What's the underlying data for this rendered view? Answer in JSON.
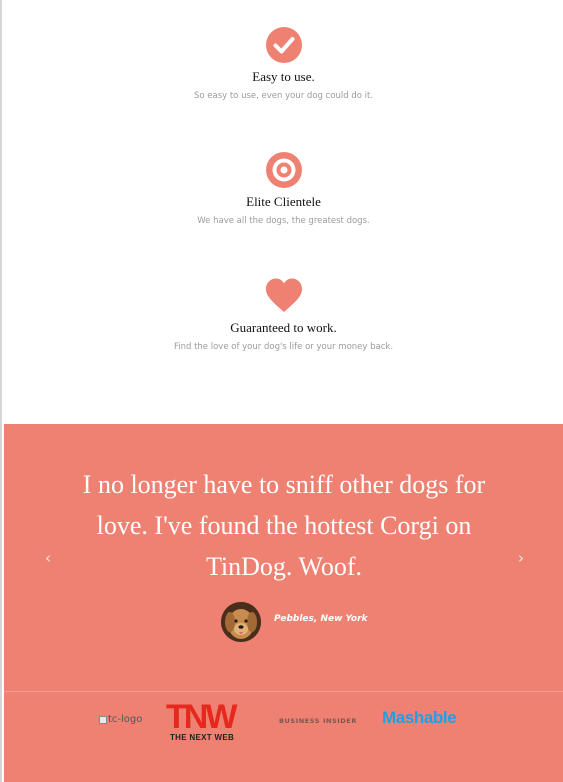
{
  "features": [
    {
      "icon": "check-circle-icon",
      "title": "Easy to use.",
      "description": "So easy to use, even your dog could do it."
    },
    {
      "icon": "bullseye-icon",
      "title": "Elite Clientele",
      "description": "We have all the dogs, the greatest dogs."
    },
    {
      "icon": "heart-icon",
      "title": "Guaranteed to work.",
      "description": "Find the love of your dog's life or your money back."
    }
  ],
  "testimonial": {
    "quote": "I no longer have to sniff other dogs for love. I've found the hottest Corgi on TinDog. Woof.",
    "author": "Pebbles, New York",
    "prev_icon": "chevron-left-icon",
    "next_icon": "chevron-right-icon"
  },
  "press": {
    "techcrunch_alt": "tc-logo",
    "tnw_mark": "TNW",
    "tnw_sub": "THE NEXT WEB",
    "business_insider": "BUSINESS INSIDER",
    "mashable": "Mashable"
  },
  "colors": {
    "accent": "#ef8172",
    "icon": "#ef8172",
    "tnw_red": "#e5291e",
    "mashable_blue": "#1f9fe8"
  }
}
